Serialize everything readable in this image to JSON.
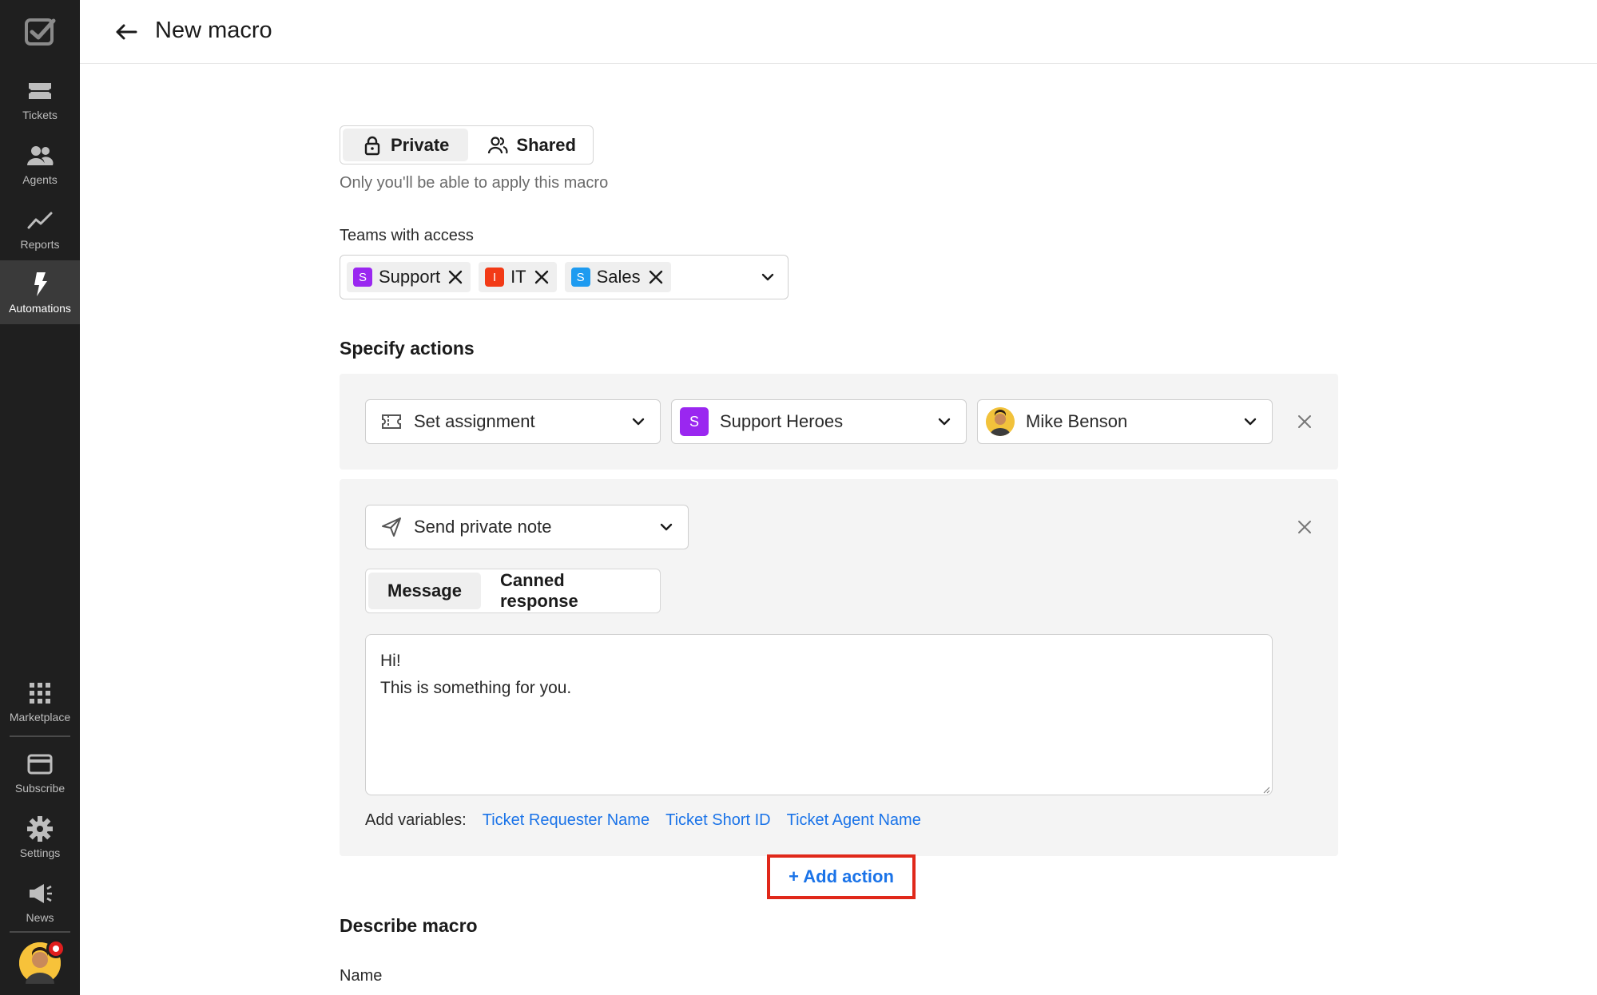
{
  "sidebar": {
    "items": [
      {
        "label": "Tickets",
        "icon": "ticket-icon"
      },
      {
        "label": "Agents",
        "icon": "agents-icon"
      },
      {
        "label": "Reports",
        "icon": "reports-icon"
      },
      {
        "label": "Automations",
        "icon": "bolt-icon",
        "active": true
      },
      {
        "label": "Marketplace",
        "icon": "grid-icon"
      },
      {
        "label": "Subscribe",
        "icon": "card-icon"
      },
      {
        "label": "Settings",
        "icon": "gear-icon"
      },
      {
        "label": "News",
        "icon": "megaphone-icon"
      }
    ]
  },
  "header": {
    "title": "New macro"
  },
  "visibility": {
    "options": [
      "Private",
      "Shared"
    ],
    "selected": "Private",
    "hint": "Only you'll be able to apply this macro"
  },
  "teams": {
    "label": "Teams with access",
    "chips": [
      {
        "badge": "S",
        "name": "Support",
        "color": "#9a27f0"
      },
      {
        "badge": "I",
        "name": "IT",
        "color": "#f23a16"
      },
      {
        "badge": "S",
        "name": "Sales",
        "color": "#1e9bf0"
      }
    ]
  },
  "actions_section": {
    "title": "Specify actions",
    "action1": {
      "type": "Set assignment",
      "team_badge": "S",
      "team": "Support Heroes",
      "agent": "Mike Benson"
    },
    "action2": {
      "type": "Send private note",
      "tabs": [
        "Message",
        "Canned response"
      ],
      "selected_tab": "Message",
      "message": "Hi!\nThis is something for you.",
      "variables_label": "Add variables:",
      "variables": [
        "Ticket Requester Name",
        "Ticket Short ID",
        "Ticket Agent Name"
      ]
    },
    "add_action_label": "+ Add action"
  },
  "describe": {
    "title": "Describe macro",
    "name_label": "Name"
  },
  "colors": {
    "sidebar_bg": "#1f1f1f",
    "link": "#1a73e8",
    "highlight": "#e0281a"
  }
}
